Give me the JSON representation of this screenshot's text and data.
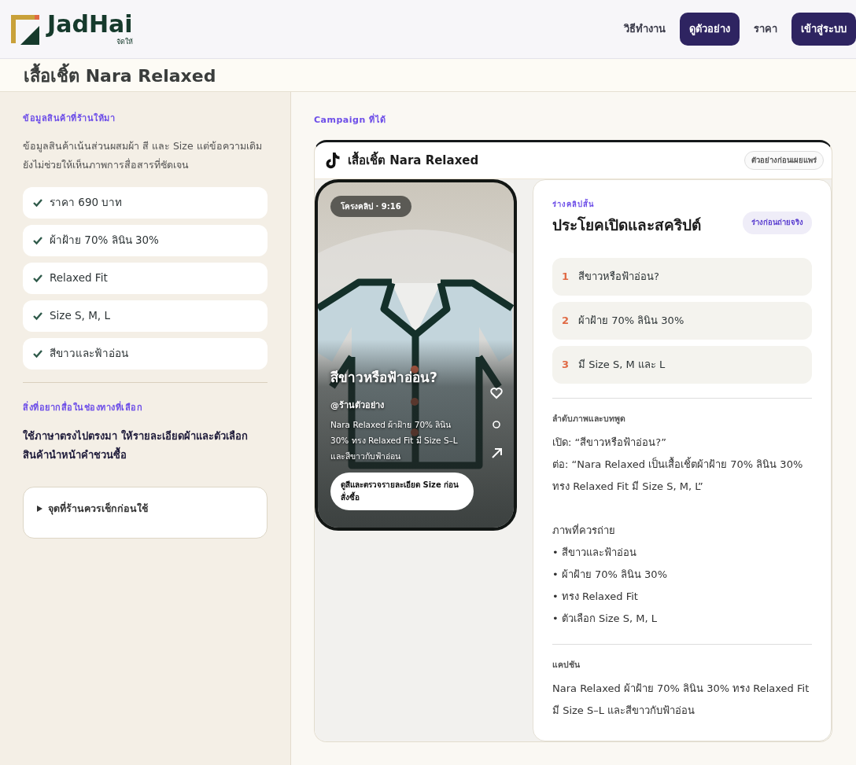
{
  "nav": {
    "brand": "JadHai",
    "brand_sub": "จัดให้",
    "links": [
      {
        "label": "วิธีทำงาน",
        "kind": "link"
      },
      {
        "label": "ดูตัวอย่าง",
        "kind": "button"
      },
      {
        "label": "ราคา",
        "kind": "link"
      },
      {
        "label": "เข้าสู่ระบบ",
        "kind": "button"
      }
    ]
  },
  "page_title": "เสื้อเชิ้ต Nara Relaxed",
  "source": {
    "heading": "ข้อมูลสินค้าที่ร้านให้มา",
    "description": "ข้อมูลสินค้าเน้นส่วนผสมผ้า สี และ Size แต่ข้อความเดิมยังไม่ช่วยให้เห็นภาพการสื่อสารที่ชัดเจน",
    "facts": [
      "ราคา 690 บาท",
      "ผ้าฝ้าย 70% ลินิน 30%",
      "Relaxed Fit",
      "Size S, M, L",
      "สีขาวและฟ้าอ่อน"
    ]
  },
  "goal": {
    "heading": "สิ่งที่อยากสื่อในช่องทางที่เลือก",
    "text": "ใช้ภาษาตรงไปตรงมา ให้รายละเอียดผ้าและตัวเลือกสินค้านำหน้าคำชวนซื้อ"
  },
  "checklist": {
    "label": "จุดที่ร้านควรเช็กก่อนใช้",
    "expanded": false
  },
  "campaign": {
    "heading": "Campaign ที่ได้",
    "title": "เสื้อเชิ้ต Nara Relaxed",
    "badge": "ตัวอย่างก่อนเผยแพร่",
    "phone": {
      "tag": "โครงคลิป · 9:16",
      "hook": "สีขาวหรือฟ้าอ่อน?",
      "handle": "@ร้านตัวอย่าง",
      "caption": "Nara Relaxed ผ้าฝ้าย 70% ลินิน 30% ทรง Relaxed Fit มี Size S–L และสีขาวกับฟ้าอ่อน",
      "cta": "ดูสีและตรวจรายละเอียด Size ก่อนสั่งซื้อ"
    },
    "script": {
      "eyebrow": "ร่างคลิปสั้น",
      "title": "ประโยคเปิดและสคริปต์",
      "badge": "ร่างก่อนถ่ายจริง",
      "hooks": [
        {
          "number": "1",
          "text": "สีขาวหรือฟ้าอ่อน?"
        },
        {
          "number": "2",
          "text": "ผ้าฝ้าย 70% ลินิน 30%"
        },
        {
          "number": "3",
          "text": "มี Size S, M และ L"
        }
      ],
      "sequence": {
        "heading": "ลำดับภาพและบทพูด",
        "lines": [
          "เปิด: “สีขาวหรือฟ้าอ่อน?”",
          "ต่อ: “Nara Relaxed เป็นเสื้อเชิ้ตผ้าฝ้าย 70% ลินิน 30% ทรง Relaxed Fit มี Size S, M, L”"
        ],
        "shots_heading": "ภาพที่ควรถ่าย",
        "shots": [
          "• สีขาวและฟ้าอ่อน",
          "• ผ้าฝ้าย 70% ลินิน 30%",
          "• ทรง Relaxed Fit",
          "• ตัวเลือก Size S, M, L"
        ]
      },
      "caption": {
        "heading": "แคปชัน",
        "text": "Nara Relaxed ผ้าฝ้าย 70% ลินิน 30% ทรง Relaxed Fit มี Size S–L และสีขาวกับฟ้าอ่อน"
      }
    }
  }
}
